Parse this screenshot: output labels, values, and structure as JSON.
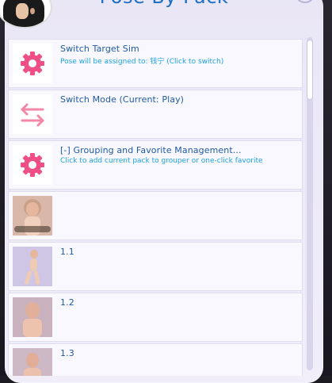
{
  "panel": {
    "title": "Pose By Pack"
  },
  "colors": {
    "accent": "#1f6fc4",
    "subtitle": "#1da3e0",
    "gear": "#ee4f86",
    "arrows": "#f287a7"
  },
  "items": [
    {
      "icon": "gear-icon",
      "title": "Switch Target Sim",
      "subtitle": "Pose will be assigned to: 钱宁 (Click to switch)"
    },
    {
      "icon": "swap-arrows-icon",
      "title": "Switch Mode (Current: Play)",
      "subtitle": ""
    },
    {
      "icon": "gear-icon",
      "title": "[-] Grouping and Favorite Management...",
      "subtitle": "Click to add current pack to grouper or one-click favorite"
    },
    {
      "icon": "pose-thumbnail",
      "title": "",
      "subtitle": ""
    },
    {
      "icon": "pose-thumbnail",
      "title": "1.1",
      "subtitle": ""
    },
    {
      "icon": "pose-thumbnail",
      "title": "1.2",
      "subtitle": ""
    },
    {
      "icon": "pose-thumbnail",
      "title": "1.3",
      "subtitle": ""
    }
  ]
}
